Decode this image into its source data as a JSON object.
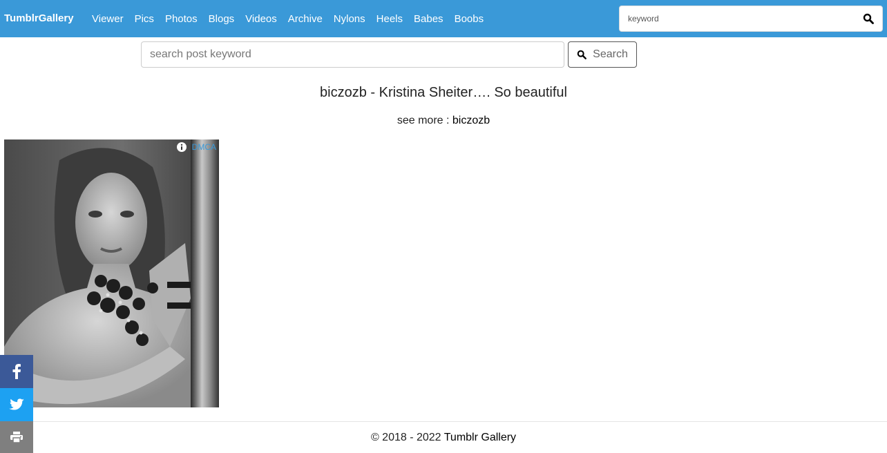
{
  "navbar": {
    "brand": "TumblrGallery",
    "links": [
      "Viewer",
      "Pics",
      "Photos",
      "Blogs",
      "Videos",
      "Archive",
      "Nylons",
      "Heels",
      "Babes",
      "Boobs"
    ],
    "search_placeholder": "keyword",
    "search_icon": "search-icon"
  },
  "post_search": {
    "placeholder": "search post keyword",
    "button_label": "Search",
    "button_icon": "search-icon"
  },
  "post": {
    "title": "biczozb - Kristina Sheiter…. So beautiful",
    "see_more_prefix": "see more : ",
    "see_more_link": "biczozb",
    "dmca_label": "DMCA",
    "dmca_icon": "info-icon"
  },
  "footer": {
    "copyright": "© 2018 - 2022 ",
    "link": "Tumblr Gallery"
  },
  "share": {
    "items": [
      "facebook-icon",
      "twitter-icon",
      "print-icon"
    ]
  },
  "colors": {
    "navbar_bg": "#3a99d8",
    "facebook": "#3b5998",
    "twitter": "#1da1f2",
    "print": "#7f7f7f"
  }
}
